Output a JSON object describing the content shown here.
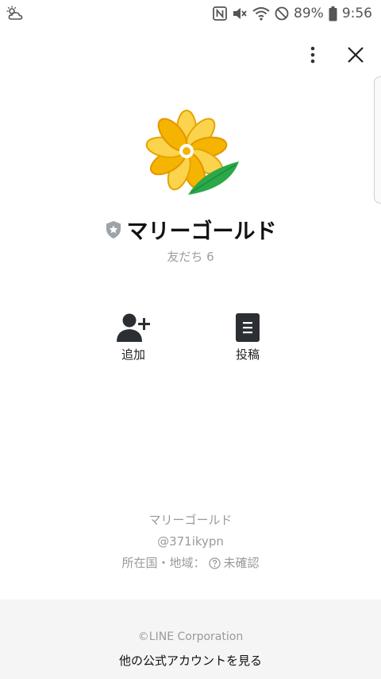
{
  "status_bar": {
    "battery_text": "89%",
    "time": "9:56",
    "icons": [
      "weather-cloud-icon",
      "nfc-icon",
      "mute-icon",
      "wifi-icon",
      "do-not-disturb-icon",
      "battery-icon"
    ]
  },
  "header": {
    "more_icon": "more-vertical-icon",
    "close_icon": "close-icon"
  },
  "profile": {
    "name": "マリーゴールド",
    "friends": "友だち 6",
    "badge_icon": "certified-shield-icon",
    "colors": {
      "petal_yellow": "#f5b400",
      "leaf_green": "#2aa84a"
    }
  },
  "actions": {
    "add_label": "追加",
    "post_label": "投稿"
  },
  "info": {
    "name": "マリーゴールド",
    "id": "@371ikypn",
    "region_label": "所在国・地域：",
    "region_value": "未確認"
  },
  "footer": {
    "copyright": "©LINE Corporation",
    "link": "他の公式アカウントを見る"
  }
}
